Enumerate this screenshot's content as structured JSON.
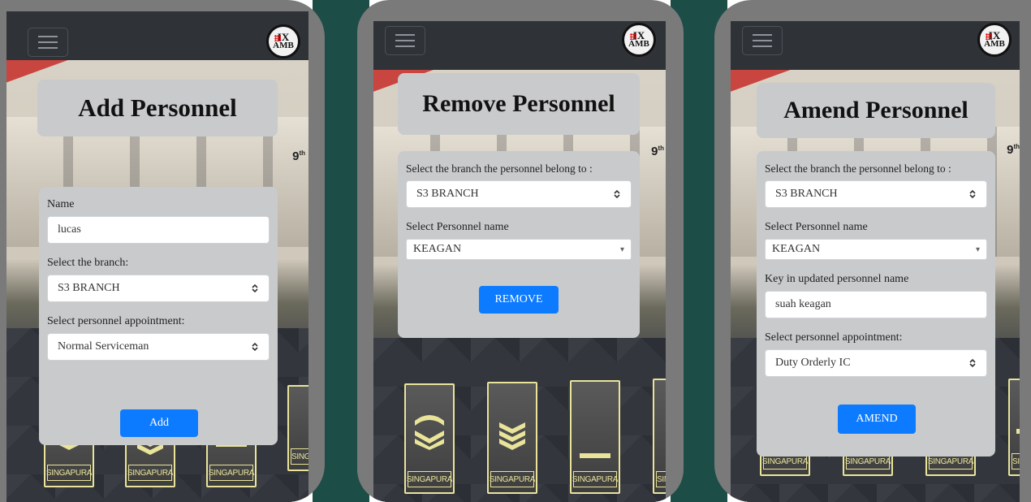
{
  "logo": {
    "line1": "IX",
    "line2": "AMB"
  },
  "badge": {
    "number": "9",
    "suffix": "th"
  },
  "rank_label": "SINGAPURA",
  "add_screen": {
    "title": "Add Personnel",
    "name_label": "Name",
    "name_value": "lucas",
    "branch_label": "Select the branch:",
    "branch_value": "S3 BRANCH",
    "appointment_label": "Select personnel appointment:",
    "appointment_value": "Normal Serviceman",
    "submit_label": "Add"
  },
  "remove_screen": {
    "title": "Remove Personnel",
    "branch_label": "Select the branch the personnel belong to :",
    "branch_value": "S3 BRANCH",
    "personnel_label": "Select Personnel name",
    "personnel_value": "KEAGAN",
    "submit_label": "REMOVE"
  },
  "amend_screen": {
    "title": "Amend Personnel",
    "branch_label": "Select the branch the personnel belong to :",
    "branch_value": "S3 BRANCH",
    "personnel_label": "Select Personnel name",
    "personnel_value": "KEAGAN",
    "updated_name_label": "Key in updated personnel name",
    "updated_name_value": "suah keagan",
    "appointment_label": "Select personnel appointment:",
    "appointment_value": "Duty Orderly IC",
    "submit_label": "AMEND"
  },
  "colors": {
    "primary_button": "#0d7bff",
    "panel": "#c9cacc",
    "navbar": "#2f3237",
    "teal_background": "#1c4d47",
    "rank_border": "#e9e49a"
  }
}
